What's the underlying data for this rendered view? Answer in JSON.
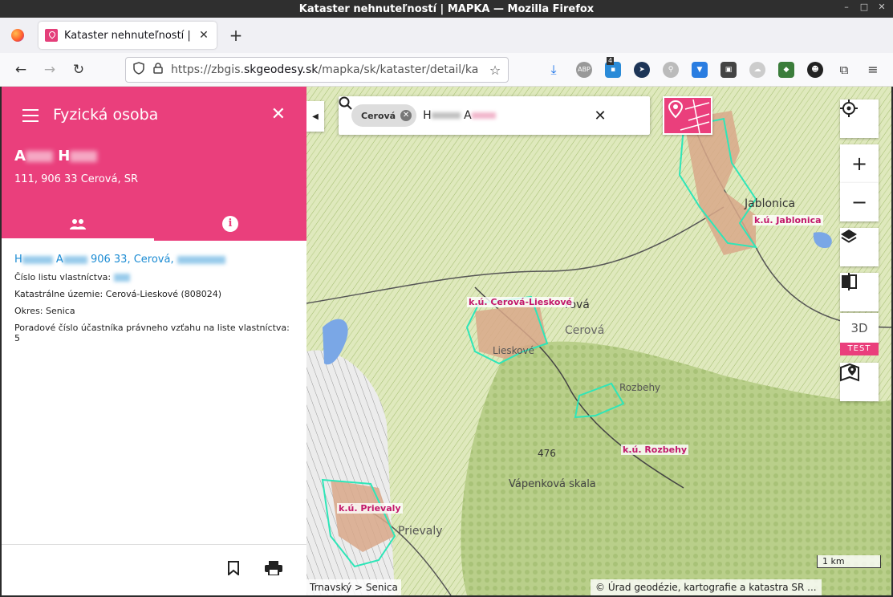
{
  "window": {
    "title": "Kataster nehnuteľností | MAPKA — Mozilla Firefox"
  },
  "browser": {
    "tab_title": "Kataster nehnuteľností |",
    "url_prefix": "https://zbgis.",
    "url_domain": "skgeodesy.sk",
    "url_rest": "/mapka/sk/kataster/detail/ka",
    "ext_badge_count": "4",
    "abp_label": "ABP"
  },
  "panel": {
    "title": "Fyzická osoba",
    "name_initial_1": "A",
    "name_initial_2": "H",
    "address": "111, 906 33 Cerová, SR",
    "owner_prefix": "H",
    "owner_mid": "A",
    "owner_suffix": "906 33, Cerová,",
    "rows": {
      "list_label": "Číslo listu vlastníctva:",
      "territory": "Katastrálne územie: Cerová-Lieskové (808024)",
      "district": "Okres: Senica",
      "order": "Poradové číslo účastníka právneho vzťahu na liste vlastníctva: 5"
    }
  },
  "search": {
    "chip_label": "Cerová",
    "query_start": "H",
    "query_mid": "A"
  },
  "map": {
    "labels": {
      "jablonica_ku": "k.ú. Jablonica",
      "cerova_ku": "k.ú. Cerová-Lieskové",
      "rozbehy_ku": "k.ú. Rozbehy",
      "prievaly_ku": "k.ú. Prievaly"
    },
    "places": {
      "jablonica": "Jablonica",
      "cerova_1": "rová",
      "cerova_2": "Cerová",
      "lieskove": "Lieskové",
      "rozbehy": "Rozbehy",
      "elevation": "476",
      "vapenkova": "Vápenková skala",
      "prievaly": "Prievaly"
    },
    "btn_3d": "3D",
    "test_badge": "TEST",
    "scale": "1 km",
    "attribution": "© Úrad geodézie, kartografie a katastra SR ...",
    "breadcrumb": "Trnavský > Senica"
  }
}
